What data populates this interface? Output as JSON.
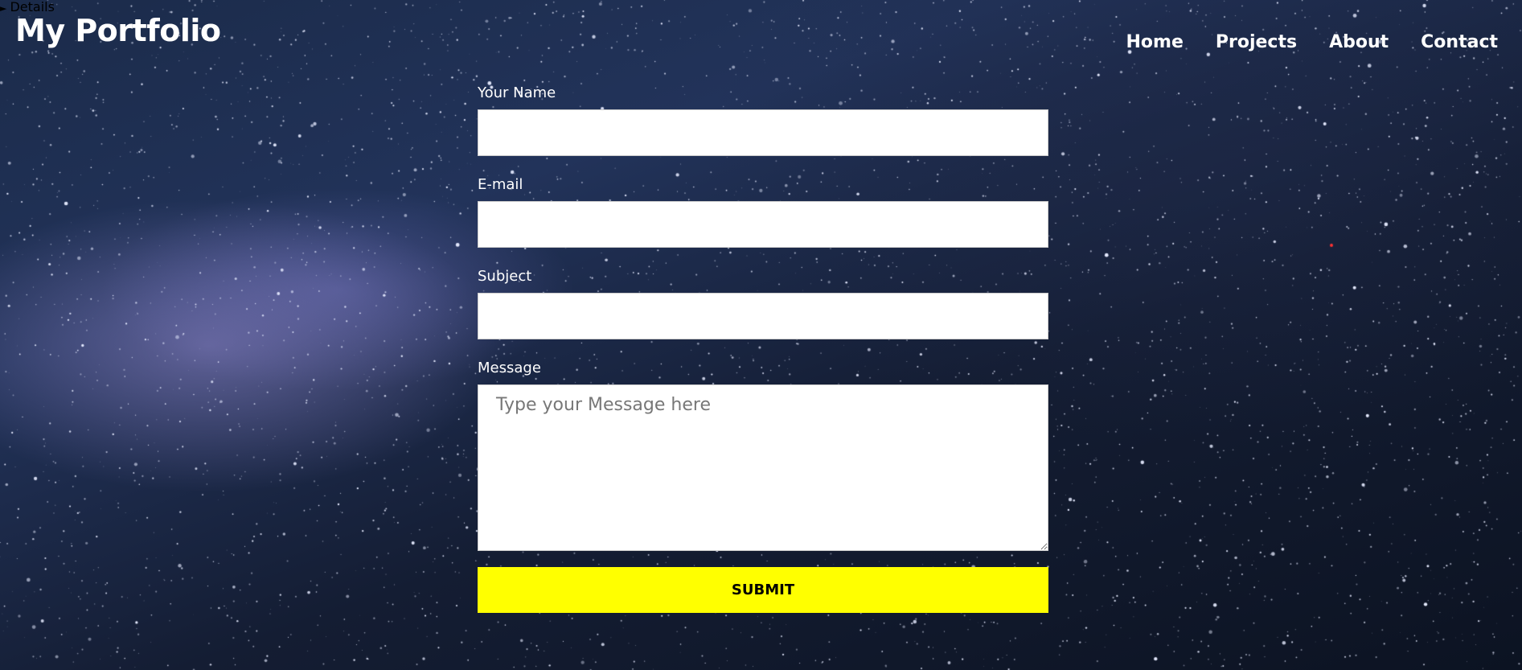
{
  "details": {
    "summary": "Details"
  },
  "header": {
    "logo": "My Portfolio",
    "nav": [
      "Home",
      "Projects",
      "About",
      "Contact"
    ]
  },
  "form": {
    "name_label": "Your Name",
    "email_label": "E-mail",
    "subject_label": "Subject",
    "message_label": "Message",
    "message_placeholder": "Type your Message here",
    "submit_label": "SUBMIT"
  },
  "colors": {
    "submit_bg": "#ffff00",
    "text": "#ffffff"
  },
  "background": {
    "icon": "starry-galaxy-background"
  }
}
